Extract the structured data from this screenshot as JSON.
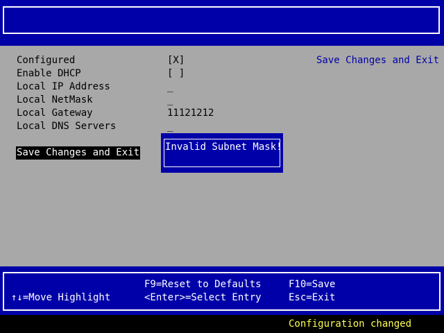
{
  "colors": {
    "header_blue": "#0000a8",
    "panel_grey": "#a8a8a8",
    "help_blue": "#0000a8",
    "highlight_bg": "#000000",
    "highlight_fg": "#ffffff",
    "status_yellow": "#ffff54"
  },
  "header": {
    "title": ""
  },
  "fields": [
    {
      "label": "Configured",
      "value": "[X]"
    },
    {
      "label": "Enable DHCP",
      "value": "[ ]"
    },
    {
      "label": "Local IP Address",
      "value": "_"
    },
    {
      "label": "Local NetMask",
      "value": "_"
    },
    {
      "label": "Local Gateway",
      "value": "11121212"
    },
    {
      "label": "Local DNS Servers",
      "value": "_"
    }
  ],
  "actions": {
    "save_exit_label": "Save Changes and Exit"
  },
  "help_panel": {
    "text": "Save Changes and Exit"
  },
  "error_popup": {
    "message": "Invalid Subnet Mask!"
  },
  "key_help": {
    "move_highlight": "↑↓=Move Highlight",
    "reset_defaults": "F9=Reset to Defaults",
    "select_entry": "<Enter>=Select Entry",
    "save": "F10=Save",
    "exit": "Esc=Exit"
  },
  "status": {
    "text": "Configuration changed"
  }
}
